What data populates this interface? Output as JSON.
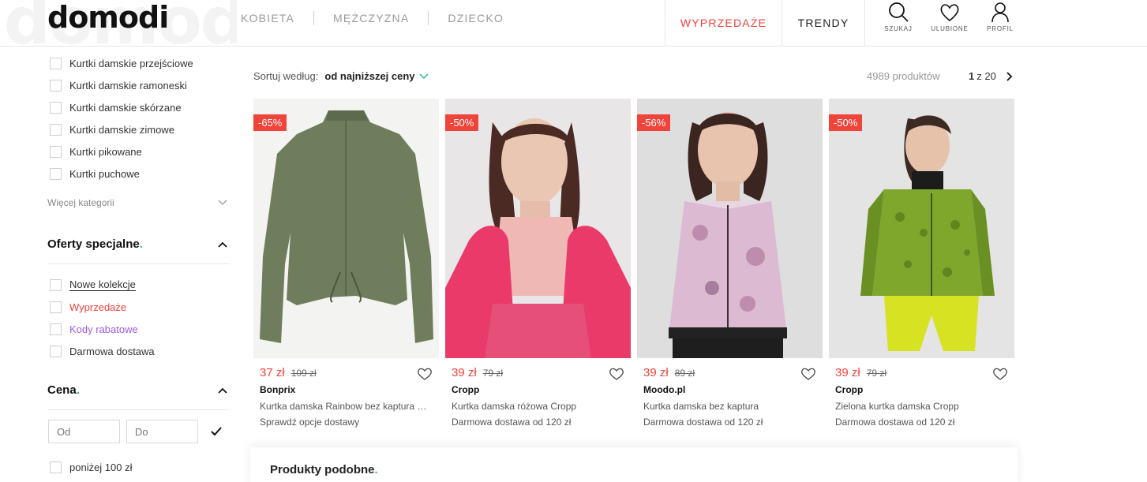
{
  "header": {
    "logo": "domodi",
    "logo_watermark": "domodi",
    "nav": [
      "KOBIETA",
      "MĘŻCZYZNA",
      "DZIECKO"
    ],
    "sale": "WYPRZEDAŻE",
    "trends": "TRENDY",
    "actions": [
      {
        "label": "SZUKAJ",
        "icon": "search-icon"
      },
      {
        "label": "ULUBIONE",
        "icon": "heart-icon"
      },
      {
        "label": "PROFIL",
        "icon": "user-icon"
      }
    ]
  },
  "sidebar": {
    "categories": [
      "Kurtki damskie przejściowe",
      "Kurtki damskie ramoneski",
      "Kurtki damskie skórzane",
      "Kurtki damskie zimowe",
      "Kurtki pikowane",
      "Kurtki puchowe"
    ],
    "more_categories": "Więcej kategorii",
    "special_title": "Oferty specjalne",
    "special_offers": [
      {
        "label": "Nowe kolekcje",
        "color": "#222222"
      },
      {
        "label": "Wyprzedaże",
        "color": "#f0433a"
      },
      {
        "label": "Kody rabatowe",
        "color": "#a259e6"
      },
      {
        "label": "Darmowa dostawa",
        "color": "#333333"
      }
    ],
    "price_title": "Cena",
    "price_from_placeholder": "Od",
    "price_to_placeholder": "Do",
    "price_option": "poniżej 100 zł"
  },
  "toolbar": {
    "sort_label": "Sortuj według:",
    "sort_value": "od najniższej ceny",
    "count": "4989 produktów",
    "page_current": "1",
    "page_total": "z 20"
  },
  "products": [
    {
      "discount": "-65%",
      "price": "37 zł",
      "old_price": "109 zł",
      "brand": "Bonprix",
      "name": "Kurtka damska Rainbow bez kaptura …",
      "shipping": "Sprawdź opcje dostawy"
    },
    {
      "discount": "-50%",
      "price": "39 zł",
      "old_price": "79 zł",
      "brand": "Cropp",
      "name": "Kurtka damska różowa Cropp",
      "shipping": "Darmowa dostawa od 120 zł"
    },
    {
      "discount": "-56%",
      "price": "39 zł",
      "old_price": "89 zł",
      "brand": "Moodo.pl",
      "name": "Kurtka damska bez kaptura",
      "shipping": "Darmowa dostawa od 120 zł"
    },
    {
      "discount": "-50%",
      "price": "39 zł",
      "old_price": "79 zł",
      "brand": "Cropp",
      "name": "Zielona kurtka damska Cropp",
      "shipping": "Darmowa dostawa od 120 zł"
    }
  ],
  "similar": {
    "title": "Produkty podobne"
  },
  "colors": {
    "accent_red": "#f0433a",
    "accent_green": "#28b89d",
    "accent_purple": "#a259e6"
  }
}
